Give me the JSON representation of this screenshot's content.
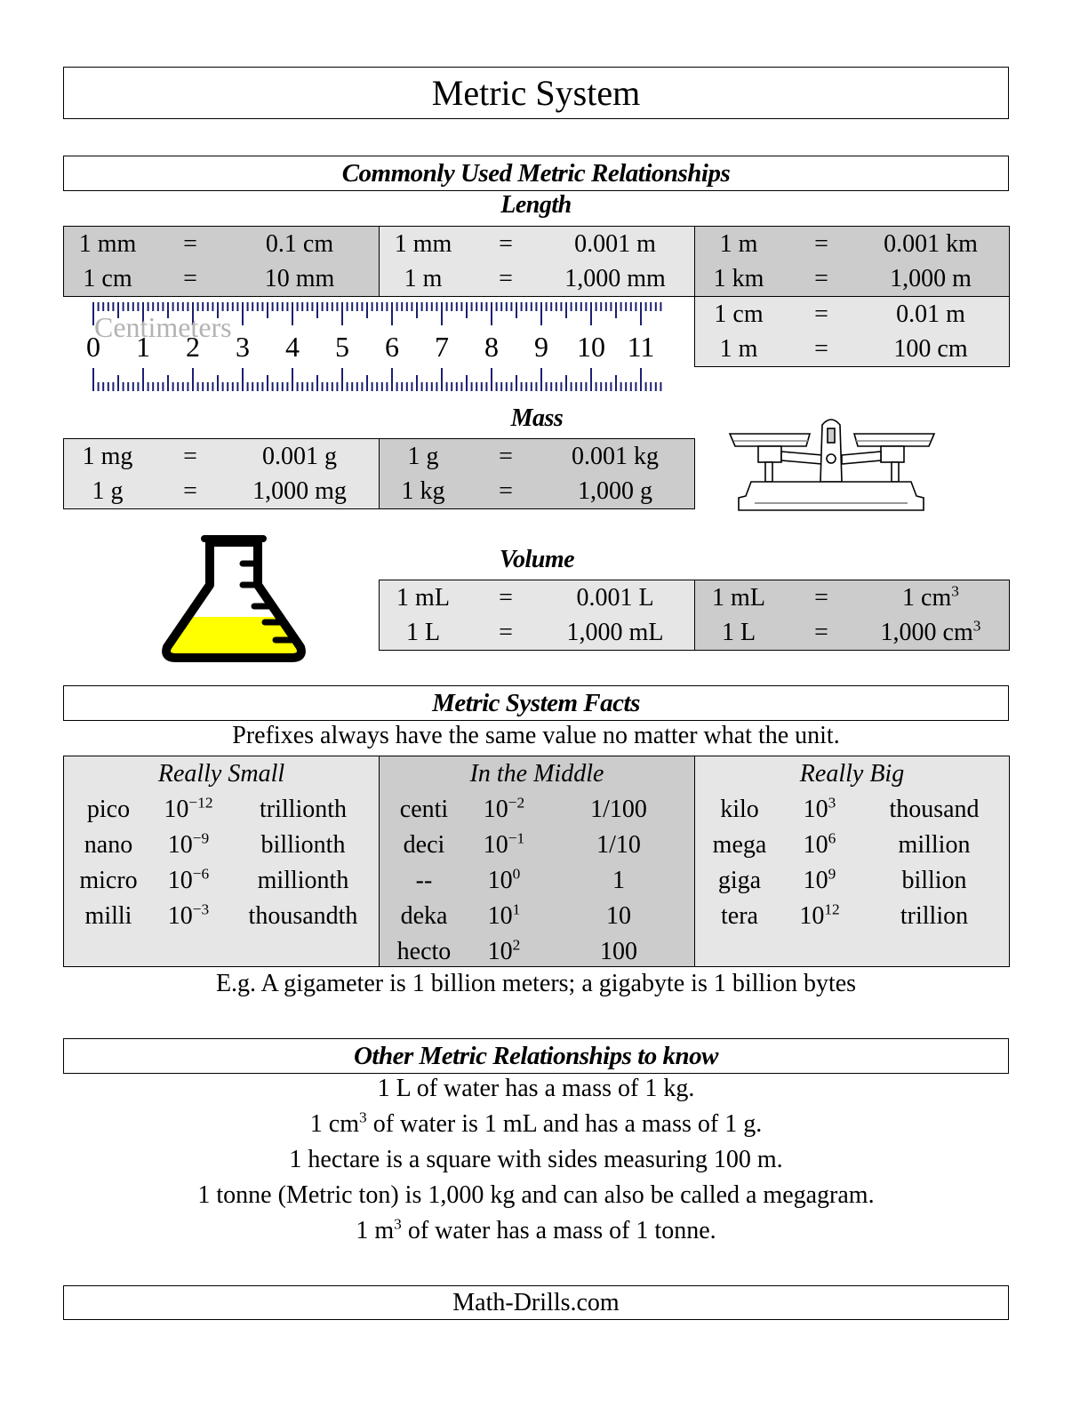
{
  "title": "Metric System",
  "sections": {
    "common": "Commonly Used Metric Relationships",
    "facts": "Metric System Facts",
    "other": "Other Metric Relationships to know"
  },
  "length": {
    "heading": "Length",
    "groups": [
      {
        "shade": "dark",
        "rows": [
          {
            "lhs": "1 mm",
            "eq": "=",
            "rhs": "0.1 cm"
          },
          {
            "lhs": "1 cm",
            "eq": "=",
            "rhs": "10 mm"
          }
        ]
      },
      {
        "shade": "light",
        "rows": [
          {
            "lhs": "1 mm",
            "eq": "=",
            "rhs": "0.001 m"
          },
          {
            "lhs": "1 m",
            "eq": "=",
            "rhs": "1,000 mm"
          }
        ]
      },
      {
        "shade": "dark",
        "rows": [
          {
            "lhs": "1 m",
            "eq": "=",
            "rhs": "0.001 km"
          },
          {
            "lhs": "1 km",
            "eq": "=",
            "rhs": "1,000 m"
          }
        ]
      },
      {
        "shade": "light",
        "rows": [
          {
            "lhs": "1 cm",
            "eq": "=",
            "rhs": "0.01 m"
          },
          {
            "lhs": "1 m",
            "eq": "=",
            "rhs": "100 cm"
          }
        ]
      }
    ]
  },
  "ruler": {
    "label": "Centimeters",
    "numbers": [
      "0",
      "1",
      "2",
      "3",
      "4",
      "5",
      "6",
      "7",
      "8",
      "9",
      "10",
      "11"
    ],
    "tick_color": "#1a1f6e"
  },
  "mass": {
    "heading": "Mass",
    "groups": [
      {
        "shade": "light",
        "rows": [
          {
            "lhs": "1 mg",
            "eq": "=",
            "rhs": "0.001 g"
          },
          {
            "lhs": "1 g",
            "eq": "=",
            "rhs": "1,000 mg"
          }
        ]
      },
      {
        "shade": "dark",
        "rows": [
          {
            "lhs": "1 g",
            "eq": "=",
            "rhs": "0.001 kg"
          },
          {
            "lhs": "1 kg",
            "eq": "=",
            "rhs": "1,000 g"
          }
        ]
      }
    ]
  },
  "volume": {
    "heading": "Volume",
    "groups": [
      {
        "shade": "light",
        "rows": [
          {
            "lhs": "1 mL",
            "eq": "=",
            "rhs": "0.001 L"
          },
          {
            "lhs": "1 L",
            "eq": "=",
            "rhs": "1,000 mL"
          }
        ]
      },
      {
        "shade": "dark",
        "rows": [
          {
            "lhs": "1 mL",
            "eq": "=",
            "rhs": "1 cm",
            "rhs_sup": "3"
          },
          {
            "lhs": "1 L",
            "eq": "=",
            "rhs": "1,000 cm",
            "rhs_sup": "3"
          }
        ]
      }
    ]
  },
  "icons": {
    "balance": "balance-scale-icon",
    "flask": "flask-icon",
    "flask_liquid_color": "#ffff00"
  },
  "facts": {
    "intro": "Prefixes always have the same value no matter what the unit.",
    "columns": [
      {
        "title": "Really Small",
        "shade": "light",
        "rows": [
          {
            "prefix": "pico",
            "base": "10",
            "exp": "−12",
            "word": "trillionth"
          },
          {
            "prefix": "nano",
            "base": "10",
            "exp": "−9",
            "word": "billionth"
          },
          {
            "prefix": "micro",
            "base": "10",
            "exp": "−6",
            "word": "millionth"
          },
          {
            "prefix": "milli",
            "base": "10",
            "exp": "−3",
            "word": "thousandth"
          }
        ]
      },
      {
        "title": "In the Middle",
        "shade": "dark",
        "rows": [
          {
            "prefix": "centi",
            "base": "10",
            "exp": "−2",
            "word": "1/100"
          },
          {
            "prefix": "deci",
            "base": "10",
            "exp": "−1",
            "word": "1/10"
          },
          {
            "prefix": "--",
            "base": "10",
            "exp": "0",
            "word": "1"
          },
          {
            "prefix": "deka",
            "base": "10",
            "exp": "1",
            "word": "10"
          },
          {
            "prefix": "hecto",
            "base": "10",
            "exp": "2",
            "word": "100"
          }
        ]
      },
      {
        "title": "Really Big",
        "shade": "light",
        "rows": [
          {
            "prefix": "kilo",
            "base": "10",
            "exp": "3",
            "word": "thousand"
          },
          {
            "prefix": "mega",
            "base": "10",
            "exp": "6",
            "word": "million"
          },
          {
            "prefix": "giga",
            "base": "10",
            "exp": "9",
            "word": "billion"
          },
          {
            "prefix": "tera",
            "base": "10",
            "exp": "12",
            "word": "trillion"
          }
        ]
      }
    ],
    "example": "E.g. A gigameter is 1 billion meters; a gigabyte is 1 billion bytes"
  },
  "other": [
    {
      "pre": "1 L of water has a mass of 1 kg.",
      "sup": "",
      "post": ""
    },
    {
      "pre": "1 cm",
      "sup": "3",
      "post": " of water is 1 mL and has a mass of 1 g."
    },
    {
      "pre": "1 hectare is a square with sides measuring 100 m.",
      "sup": "",
      "post": ""
    },
    {
      "pre": "1 tonne (Metric ton) is 1,000 kg and can also be called a megagram.",
      "sup": "",
      "post": ""
    },
    {
      "pre": "1 m",
      "sup": "3",
      "post": " of water has a mass of 1 tonne."
    }
  ],
  "colors": {
    "dark_cell": "#cccccc",
    "light_cell": "#e6e6e6",
    "border": "#000000"
  },
  "footer": "Math-Drills.com"
}
